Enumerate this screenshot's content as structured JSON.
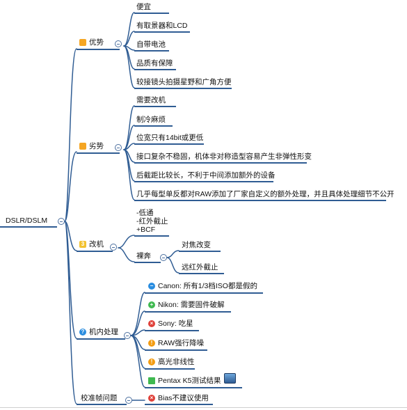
{
  "root": {
    "label": "DSLR/DSLM"
  },
  "branches": [
    {
      "label": "优势",
      "icon": "orange-folder-icon",
      "children": [
        {
          "label": "便宜"
        },
        {
          "label": "有取景器和LCD"
        },
        {
          "label": "自带电池"
        },
        {
          "label": "品质有保障"
        },
        {
          "label": "较接镜头拍摄星野和广角方便"
        }
      ]
    },
    {
      "label": "劣势",
      "icon": "orange-folder-icon",
      "children": [
        {
          "label": "需要改机"
        },
        {
          "label": "制冷麻烦"
        },
        {
          "label": "位宽只有14bit或更低"
        },
        {
          "label": "接口复杂不稳固，机体非对称造型容易产生非弹性形变"
        },
        {
          "label": "后截距比较长，不利于中间添加额外的设备"
        },
        {
          "label": "几乎每型单反都对RAW添加了厂家自定义的额外处理，并且具体处理细节不公开"
        }
      ]
    },
    {
      "label": "改机",
      "icon": "number-3-badge-icon",
      "children": [
        {
          "label": "-低通\n-红外截止\n+BCF"
        },
        {
          "label": "裸奔",
          "children": [
            {
              "label": "对焦改变"
            },
            {
              "label": "远红外截止"
            }
          ]
        }
      ]
    },
    {
      "label": "机内处理",
      "icon": "question-circle-icon",
      "children": [
        {
          "label": "Canon: 所有1/3档ISO都是假的",
          "icon": "minus-circle-icon"
        },
        {
          "label": "Nikon: 需要固件破解",
          "icon": "plus-circle-icon"
        },
        {
          "label": "Sony: 吃星",
          "icon": "x-circle-icon"
        },
        {
          "label": "RAW强行降噪",
          "icon": "exclamation-circle-icon"
        },
        {
          "label": "高光非线性",
          "icon": "exclamation-circle-icon"
        },
        {
          "label": "Pentax K5测试结果",
          "icon": "pencil-icon",
          "attachment": "image-attachment-icon"
        }
      ]
    },
    {
      "label": "校准帧问题",
      "icon": "",
      "children": [
        {
          "label": "Bias不建议使用",
          "icon": "x-circle-icon"
        }
      ]
    }
  ],
  "colors": {
    "line": "#2f5c93",
    "orange": "#f5a623",
    "blue": "#2a8de0",
    "green": "#3fb950",
    "red": "#e0413a",
    "amber": "#f39c12"
  }
}
